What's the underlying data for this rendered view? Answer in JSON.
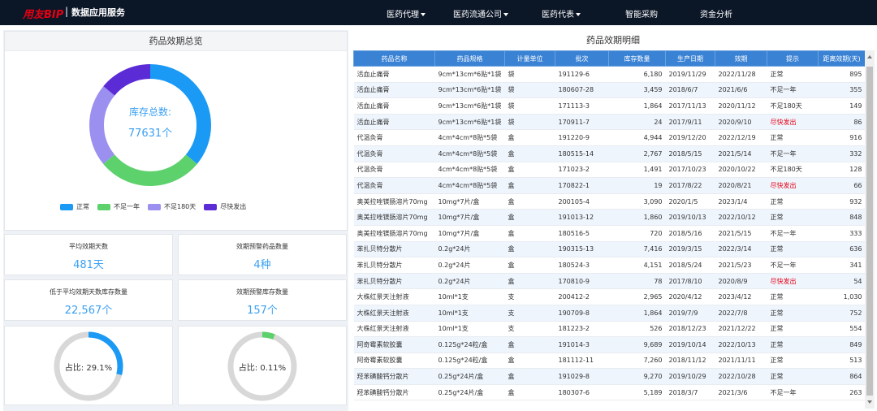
{
  "header": {
    "logo": "用友BIP",
    "separator": "|",
    "subtitle": "数据应用服务",
    "nav": [
      {
        "label": "医药代理",
        "dropdown": true
      },
      {
        "label": "医药流通公司",
        "dropdown": true
      },
      {
        "label": "医药代表",
        "dropdown": true
      },
      {
        "label": "智能采购",
        "dropdown": false
      },
      {
        "label": "资金分析",
        "dropdown": false
      }
    ]
  },
  "overview": {
    "title": "药品效期总览",
    "center_title": "库存总数:",
    "center_value": "77631个",
    "legend": [
      {
        "label": "正常",
        "color": "#1a9af5"
      },
      {
        "label": "不足一年",
        "color": "#5cd16c"
      },
      {
        "label": "不足180天",
        "color": "#9b8ff0"
      },
      {
        "label": "尽快发出",
        "color": "#5b2bd6"
      }
    ],
    "segments": [
      0.36,
      0.28,
      0.22,
      0.14
    ]
  },
  "stats": [
    {
      "title": "平均效期天数",
      "value": "481天"
    },
    {
      "title": "效期预警药品数量",
      "value": "4种"
    },
    {
      "title": "低于平均效期天数库存数量",
      "value": "22,567个"
    },
    {
      "title": "效期预警库存数量",
      "value": "157个"
    }
  ],
  "rings": [
    {
      "label": "占比:  29.1%",
      "fraction": 0.291,
      "color": "#1a9af5"
    },
    {
      "label": "占比:  0.11%",
      "fraction": 0.06,
      "color": "#5cd16c"
    }
  ],
  "detail": {
    "title": "药品效期明细",
    "columns": [
      "药品名称",
      "药品规格",
      "计量单位",
      "批次",
      "库存数量",
      "生产日期",
      "效期",
      "提示",
      "距离效期(天)"
    ],
    "rows": [
      [
        "活血止痛膏",
        "9cm*13cm*6贴*1袋",
        "袋",
        "191129-6",
        "6,180",
        "2019/11/29",
        "2022/11/28",
        "正常",
        "895"
      ],
      [
        "活血止痛膏",
        "9cm*13cm*6贴*1袋",
        "袋",
        "180607-28",
        "3,459",
        "2018/6/7",
        "2021/6/6",
        "不足一年",
        "355"
      ],
      [
        "活血止痛膏",
        "9cm*13cm*6贴*1袋",
        "袋",
        "171113-3",
        "1,864",
        "2017/11/13",
        "2020/11/12",
        "不足180天",
        "149"
      ],
      [
        "活血止痛膏",
        "9cm*13cm*6贴*1袋",
        "袋",
        "170911-7",
        "24",
        "2017/9/11",
        "2020/9/10",
        "尽快发出",
        "86"
      ],
      [
        "代温灸膏",
        "4cm*4cm*8贴*5袋",
        "盒",
        "191220-9",
        "4,944",
        "2019/12/20",
        "2022/12/19",
        "正常",
        "916"
      ],
      [
        "代温灸膏",
        "4cm*4cm*8贴*5袋",
        "盒",
        "180515-14",
        "2,767",
        "2018/5/15",
        "2021/5/14",
        "不足一年",
        "332"
      ],
      [
        "代温灸膏",
        "4cm*4cm*8贴*5袋",
        "盒",
        "171023-2",
        "1,491",
        "2017/10/23",
        "2020/10/22",
        "不足180天",
        "128"
      ],
      [
        "代温灸膏",
        "4cm*4cm*8贴*5袋",
        "盒",
        "170822-1",
        "19",
        "2017/8/22",
        "2020/8/21",
        "尽快发出",
        "66"
      ],
      [
        "奥美拉唑镁肠溶片70mg",
        "10mg*7片/盒",
        "盒",
        "200105-4",
        "3,090",
        "2020/1/5",
        "2023/1/4",
        "正常",
        "932"
      ],
      [
        "奥美拉唑镁肠溶片70mg",
        "10mg*7片/盒",
        "盒",
        "191013-12",
        "1,860",
        "2019/10/13",
        "2022/10/12",
        "正常",
        "848"
      ],
      [
        "奥美拉唑镁肠溶片70mg",
        "10mg*7片/盒",
        "盒",
        "180516-5",
        "720",
        "2018/5/16",
        "2021/5/15",
        "不足一年",
        "333"
      ],
      [
        "苯扎贝特分散片",
        "0.2g*24片",
        "盒",
        "190315-13",
        "7,416",
        "2019/3/15",
        "2022/3/14",
        "正常",
        "636"
      ],
      [
        "苯扎贝特分散片",
        "0.2g*24片",
        "盒",
        "180524-3",
        "4,151",
        "2018/5/24",
        "2021/5/23",
        "不足一年",
        "341"
      ],
      [
        "苯扎贝特分散片",
        "0.2g*24片",
        "盒",
        "170810-9",
        "78",
        "2017/8/10",
        "2020/8/9",
        "尽快发出",
        "54"
      ],
      [
        "大株红景天注射液",
        "10ml*1支",
        "支",
        "200412-2",
        "2,965",
        "2020/4/12",
        "2023/4/12",
        "正常",
        "1,030"
      ],
      [
        "大株红景天注射液",
        "10ml*1支",
        "支",
        "190709-8",
        "1,864",
        "2019/7/9",
        "2022/7/8",
        "正常",
        "752"
      ],
      [
        "大株红景天注射液",
        "10ml*1支",
        "支",
        "181223-2",
        "526",
        "2018/12/23",
        "2021/12/22",
        "正常",
        "554"
      ],
      [
        "阿奇霉素软胶囊",
        "0.125g*24粒/盒",
        "盒",
        "191014-3",
        "9,689",
        "2019/10/14",
        "2022/10/13",
        "正常",
        "849"
      ],
      [
        "阿奇霉素软胶囊",
        "0.125g*24粒/盒",
        "盒",
        "181112-11",
        "7,260",
        "2018/11/12",
        "2021/11/11",
        "正常",
        "513"
      ],
      [
        "羟苯磺酸钙分散片",
        "0.25g*24片/盒",
        "盒",
        "191029-8",
        "9,270",
        "2019/10/29",
        "2022/10/28",
        "正常",
        "864"
      ],
      [
        "羟苯磺酸钙分散片",
        "0.25g*24片/盒",
        "盒",
        "180307-6",
        "5,189",
        "2018/3/7",
        "2021/3/6",
        "不足一年",
        "263"
      ]
    ]
  }
}
